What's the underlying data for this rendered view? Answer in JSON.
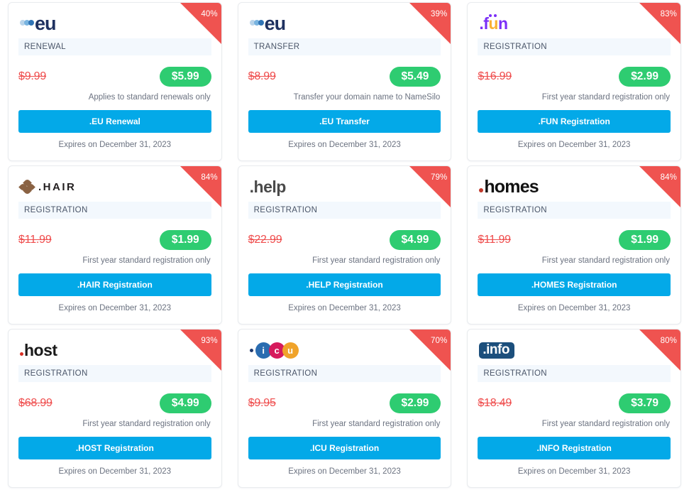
{
  "cards": [
    {
      "tld": ".eu",
      "logo_style": "eu",
      "logo_text": "eu",
      "discount": "40%",
      "type": "RENEWAL",
      "old_price": "$9.99",
      "new_price": "$5.99",
      "note": "Applies to standard renewals only",
      "cta": ".EU Renewal",
      "expiry": "Expires on December 31, 2023"
    },
    {
      "tld": ".eu",
      "logo_style": "eu",
      "logo_text": "eu",
      "discount": "39%",
      "type": "TRANSFER",
      "old_price": "$8.99",
      "new_price": "$5.49",
      "note": "Transfer your domain name to NameSilo",
      "cta": ".EU Transfer",
      "expiry": "Expires on December 31, 2023"
    },
    {
      "tld": ".fun",
      "logo_style": "fun",
      "logo_text": ".fun",
      "discount": "83%",
      "type": "REGISTRATION",
      "old_price": "$16.99",
      "new_price": "$2.99",
      "note": "First year standard registration only",
      "cta": ".FUN Registration",
      "expiry": "Expires on December 31, 2023"
    },
    {
      "tld": ".hair",
      "logo_style": "hair",
      "logo_text": ".HAIR",
      "discount": "84%",
      "type": "REGISTRATION",
      "old_price": "$11.99",
      "new_price": "$1.99",
      "note": "First year standard registration only",
      "cta": ".HAIR Registration",
      "expiry": "Expires on December 31, 2023"
    },
    {
      "tld": ".help",
      "logo_style": "help",
      "logo_text": ".help",
      "discount": "79%",
      "type": "REGISTRATION",
      "old_price": "$22.99",
      "new_price": "$4.99",
      "note": "First year standard registration only",
      "cta": ".HELP Registration",
      "expiry": "Expires on December 31, 2023"
    },
    {
      "tld": ".homes",
      "logo_style": "homes",
      "logo_text": "homes",
      "discount": "84%",
      "type": "REGISTRATION",
      "old_price": "$11.99",
      "new_price": "$1.99",
      "note": "First year standard registration only",
      "cta": ".HOMES Registration",
      "expiry": "Expires on December 31, 2023"
    },
    {
      "tld": ".host",
      "logo_style": "host",
      "logo_text": "host",
      "discount": "93%",
      "type": "REGISTRATION",
      "old_price": "$68.99",
      "new_price": "$4.99",
      "note": "First year standard registration only",
      "cta": ".HOST Registration",
      "expiry": "Expires on December 31, 2023"
    },
    {
      "tld": ".icu",
      "logo_style": "icu",
      "logo_letters": [
        "i",
        "c",
        "u"
      ],
      "discount": "70%",
      "type": "REGISTRATION",
      "old_price": "$9.95",
      "new_price": "$2.99",
      "note": "First year standard registration only",
      "cta": ".ICU Registration",
      "expiry": "Expires on December 31, 2023"
    },
    {
      "tld": ".info",
      "logo_style": "info",
      "logo_text": ".info",
      "discount": "80%",
      "type": "REGISTRATION",
      "old_price": "$18.49",
      "new_price": "$3.79",
      "note": "First year standard registration only",
      "cta": ".INFO Registration",
      "expiry": "Expires on December 31, 2023"
    }
  ],
  "colors": {
    "ribbon": "#ef5350",
    "sale_price": "#2ecc71",
    "old_price": "#ef4d4d",
    "cta": "#03a9e8",
    "type_bar": "#f3f8fd"
  }
}
